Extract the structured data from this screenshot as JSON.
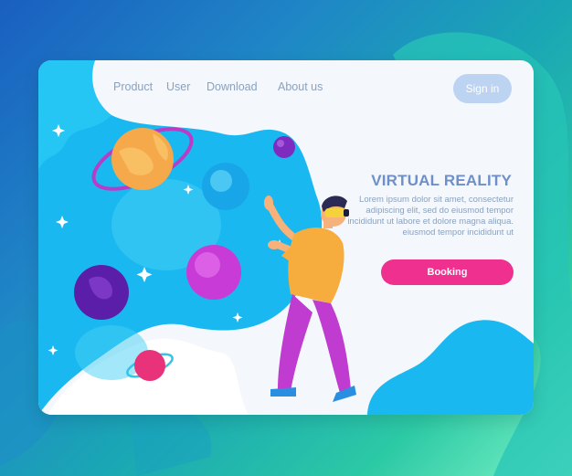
{
  "nav": {
    "items": [
      {
        "label": "Product"
      },
      {
        "label": "User"
      },
      {
        "label": "Download"
      },
      {
        "label": "About us"
      }
    ],
    "signin_label": "Sign in"
  },
  "hero": {
    "title": "VIRTUAL REALITY",
    "description": "Lorem ipsum dolor sit amet, consectetur adipiscing elit, sed do eiusmod tempor incididunt ut labore et dolore magna aliqua. eiusmod tempor incididunt ut",
    "cta_label": "Booking"
  },
  "colors": {
    "accent": "#f0308f",
    "title": "#6f8fc9",
    "nav_text": "#8aa2bf",
    "signin_bg": "#bcd3f2",
    "sky": "#1ab8f0"
  },
  "icons": [
    "planet-icon",
    "star-icon"
  ]
}
